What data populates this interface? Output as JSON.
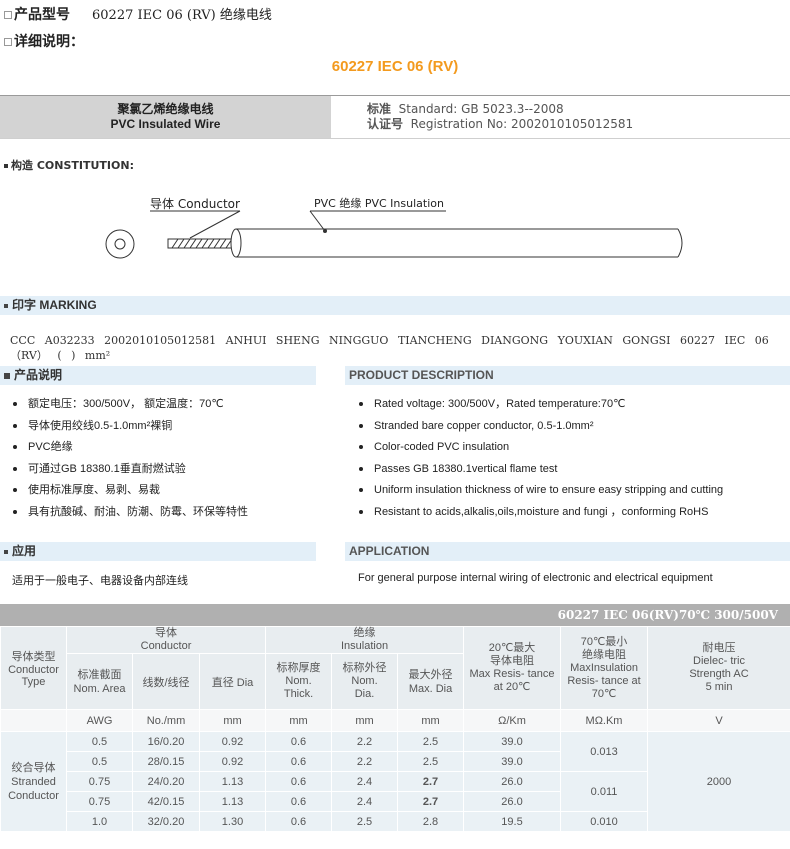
{
  "header": {
    "model_label": "产品型号",
    "model_value": "60227 IEC 06 (RV) 绝缘电线",
    "details_label": "详细说明："
  },
  "main_title": "60227 IEC 06 (RV)",
  "title_bar": {
    "name_cn": "聚氯乙烯绝缘电线",
    "name_en": "PVC Insulated Wire",
    "standard_label": "标准",
    "standard_value": "Standard: GB 5023.3--2008",
    "reg_label": "认证号",
    "reg_value": "Registration No:  2002010105012581"
  },
  "construction": {
    "label": "构造  CONSTITUTION:",
    "conductor_label": "导体 Conductor",
    "insulation_label": "PVC 绝缘 PVC Insulation"
  },
  "marking": {
    "label": "印字  MARKING",
    "text": "CCC A032233 2002010105012581 ANHUI SHENG NINGGUO TIANCHENG DIANGONG YOUXIAN GONGSI 60227 IEC 06（RV） ( ) mm²"
  },
  "product_desc_cn": {
    "label": "产品说明",
    "items": [
      "额定电压：300/500V，  额定温度：70℃",
      "导体使用绞线0.5-1.0mm²裸铜",
      "PVC绝缘",
      "可通过GB 18380.1垂直耐燃试验",
      "使用标准厚度、易剥、易裁",
      "具有抗酸碱、耐油、防潮、防霉、环保等特性"
    ]
  },
  "product_desc_en": {
    "label": "PRODUCT DESCRIPTION",
    "items": [
      "Rated voltage: 300/500V，Rated temperature:70℃",
      "Stranded bare copper conductor, 0.5-1.0mm²",
      "Color-coded PVC insulation",
      "Passes GB 18380.1vertical flame test",
      "Uniform insulation thickness of wire to ensure easy stripping and cutting",
      "Resistant to acids,alkalis,oils,moisture and fungi ，conforming RoHS"
    ]
  },
  "application_cn": {
    "label": "应用",
    "text": "适用于一般电子、电器设备内部连线"
  },
  "application_en": {
    "label": "APPLICATION",
    "text": "For general purpose internal wiring of electronic and electrical equipment"
  },
  "table": {
    "title": "60227 IEC 06(RV)70℃ 300/500V",
    "group_conductor": "导体\nConductor",
    "group_insulation": "绝缘\nInsulation",
    "h_type": "导体类型\nConductor\nType",
    "h_area": "标准截面\nNom. Area",
    "h_strand": "线数/线径",
    "h_dia": "直径  Dia",
    "h_thick": "标称厚度\nNom.\nThick.",
    "h_outer": "标称外径\nNom.\nDia.",
    "h_max": "最大外径\nMax. Dia",
    "h_res20": "20℃最大\n导体电阻\nMax Resis- tance\nat 20℃",
    "h_res70": "70℃最小\n绝缘电阻\nMaxInsulation\nResis- tance at\n70℃",
    "h_volt": "耐电压\nDielec- tric\nStrength AC\n5 min",
    "units": [
      "AWG",
      "No./mm",
      "mm",
      "mm",
      "mm",
      "mm",
      "Ω/Km",
      "MΩ.Km",
      "V"
    ],
    "type_label": "绞合导体\nStranded\nConductor",
    "rows": [
      [
        "0.5",
        "16/0.20",
        "0.92",
        "0.6",
        "2.2",
        "2.5",
        "39.0"
      ],
      [
        "0.5",
        "28/0.15",
        "0.92",
        "0.6",
        "2.2",
        "2.5",
        "39.0"
      ],
      [
        "0.75",
        "24/0.20",
        "1.13",
        "0.6",
        "2.4",
        "2.7",
        "26.0"
      ],
      [
        "0.75",
        "42/0.15",
        "1.13",
        "0.6",
        "2.4",
        "2.7",
        "26.0"
      ],
      [
        "1.0",
        "32/0.20",
        "1.30",
        "0.6",
        "2.5",
        "2.8",
        "19.5"
      ]
    ],
    "res70_values": [
      "0.013",
      "0.011",
      "0.010"
    ],
    "voltage": "2000"
  }
}
